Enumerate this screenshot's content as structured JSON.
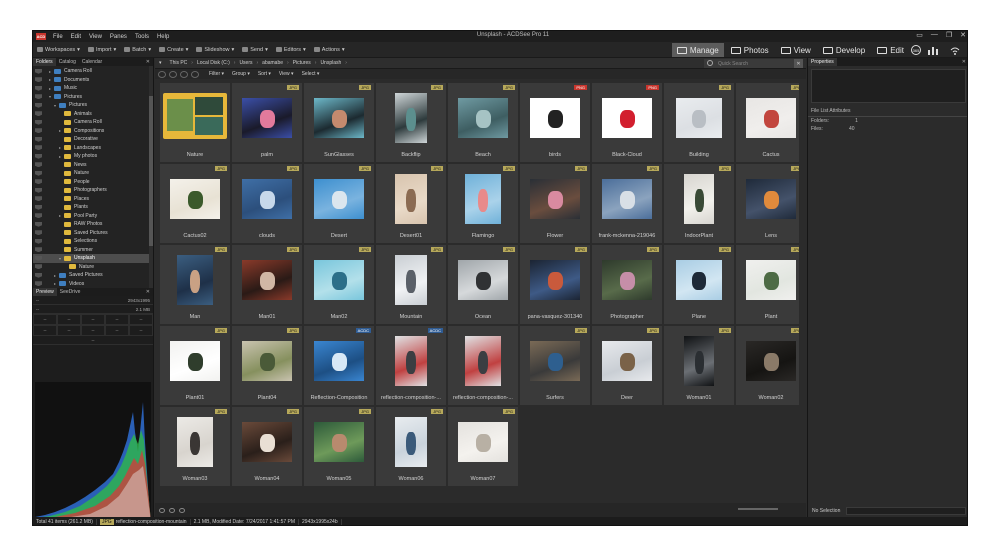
{
  "app": {
    "title": "Unsplash - ACDSee Pro 11",
    "logo": "ACD",
    "window_buttons": [
      "▭",
      "—",
      "❐",
      "✕"
    ]
  },
  "menu": [
    "File",
    "Edit",
    "View",
    "Panes",
    "Tools",
    "Help"
  ],
  "toolbar": {
    "items": [
      "Workspaces",
      "Import",
      "Batch",
      "Create",
      "Slideshow",
      "Send",
      "Editors",
      "Actions"
    ],
    "modes": [
      "Manage",
      "Photos",
      "View",
      "Develop",
      "Edit"
    ],
    "active_mode": "Manage",
    "badge_365": "365"
  },
  "folders_panel": {
    "tabs": [
      "Folders",
      "Catalog",
      "Calendar"
    ],
    "pin": "✕",
    "tree": [
      {
        "label": "Camera Roll",
        "indent": 1,
        "arrow": "▸",
        "icon": "blue"
      },
      {
        "label": "Documents",
        "indent": 1,
        "arrow": "▸",
        "icon": "blue"
      },
      {
        "label": "Music",
        "indent": 1,
        "arrow": "▸",
        "icon": "blue"
      },
      {
        "label": "Pictures",
        "indent": 1,
        "arrow": "▾",
        "icon": "blue"
      },
      {
        "label": "Pictures",
        "indent": 2,
        "arrow": "▾",
        "icon": "blue"
      },
      {
        "label": "Animals",
        "indent": 3,
        "arrow": "",
        "icon": "yellow"
      },
      {
        "label": "Camera Roll",
        "indent": 3,
        "arrow": "",
        "icon": "yellow"
      },
      {
        "label": "Compositions",
        "indent": 3,
        "arrow": "▸",
        "icon": "yellow"
      },
      {
        "label": "Decorative",
        "indent": 3,
        "arrow": "",
        "icon": "yellow"
      },
      {
        "label": "Landscapes",
        "indent": 3,
        "arrow": "▸",
        "icon": "yellow"
      },
      {
        "label": "My photos",
        "indent": 3,
        "arrow": "▸",
        "icon": "yellow"
      },
      {
        "label": "News",
        "indent": 3,
        "arrow": "",
        "icon": "yellow"
      },
      {
        "label": "Nature",
        "indent": 3,
        "arrow": "",
        "icon": "yellow"
      },
      {
        "label": "People",
        "indent": 3,
        "arrow": "",
        "icon": "yellow"
      },
      {
        "label": "Photographers",
        "indent": 3,
        "arrow": "",
        "icon": "yellow"
      },
      {
        "label": "Places",
        "indent": 3,
        "arrow": "",
        "icon": "yellow"
      },
      {
        "label": "Plants",
        "indent": 3,
        "arrow": "",
        "icon": "yellow"
      },
      {
        "label": "Pool Party",
        "indent": 3,
        "arrow": "▸",
        "icon": "yellow"
      },
      {
        "label": "RAW Photos",
        "indent": 3,
        "arrow": "",
        "icon": "yellow"
      },
      {
        "label": "Saved Pictures",
        "indent": 3,
        "arrow": "",
        "icon": "yellow"
      },
      {
        "label": "Selections",
        "indent": 3,
        "arrow": "",
        "icon": "yellow"
      },
      {
        "label": "Summer",
        "indent": 3,
        "arrow": "",
        "icon": "yellow"
      },
      {
        "label": "Unsplash",
        "indent": 3,
        "arrow": "▾",
        "icon": "yellow",
        "selected": true
      },
      {
        "label": "Nature",
        "indent": 4,
        "arrow": "",
        "icon": "yellow"
      },
      {
        "label": "Saved Pictures",
        "indent": 2,
        "arrow": "▸",
        "icon": "blue"
      },
      {
        "label": "Videos",
        "indent": 2,
        "arrow": "▸",
        "icon": "blue"
      }
    ]
  },
  "preview_panel": {
    "tabs": [
      "Preview",
      "SeeDrive"
    ],
    "pin": "✕",
    "dimensions": "2943x1995",
    "size": "2.1 MB",
    "row1_left": "--",
    "row2_left": "--",
    "grid": [
      "--",
      "--",
      "--",
      "--",
      "--",
      "--",
      "--",
      "--",
      "--",
      "--"
    ],
    "bottom": "--"
  },
  "address_bar": {
    "path": [
      "This PC",
      "Local Disk (C:)",
      "Users",
      "abamabe",
      "Pictures",
      "Unsplash"
    ],
    "search_placeholder": "Quick Search",
    "clear": "✕"
  },
  "filter_bar": [
    "Filter",
    "Group",
    "Sort",
    "View",
    "Select"
  ],
  "files": [
    {
      "name": "Nature",
      "badge": "",
      "type": "folder"
    },
    {
      "name": "palm",
      "badge": "JPG",
      "colors": [
        "#3b4fa8",
        "#e27a9c",
        "#1a1a2a"
      ]
    },
    {
      "name": "SunGlasses",
      "badge": "JPG",
      "colors": [
        "#6db8c9",
        "#c48a6e",
        "#1c2a30"
      ]
    },
    {
      "name": "Backflip",
      "badge": "JPG",
      "colors": [
        "#cfd6d8",
        "#5c8f8e",
        "#2d3a3c"
      ]
    },
    {
      "name": "Beach",
      "badge": "JPG",
      "colors": [
        "#6f9aa2",
        "#a6c3c4",
        "#3e5e62"
      ]
    },
    {
      "name": "birds",
      "badge": "PNG",
      "colors": [
        "#ffffff",
        "#222222",
        "#ffffff"
      ]
    },
    {
      "name": "Black-Cloud",
      "badge": "PNG",
      "colors": [
        "#ffffff",
        "#d21f2e",
        "#ffffff"
      ]
    },
    {
      "name": "Building",
      "badge": "JPG",
      "colors": [
        "#e9ecef",
        "#b9bec4",
        "#dcdfe3"
      ]
    },
    {
      "name": "Cactus",
      "badge": "JPG",
      "colors": [
        "#e8e6e4",
        "#c2463e",
        "#f0eeec"
      ]
    },
    {
      "name": "Cactus02",
      "badge": "JPG",
      "colors": [
        "#f4f1ea",
        "#3b5a2b",
        "#e8e2d4"
      ]
    },
    {
      "name": "clouds",
      "badge": "JPG",
      "colors": [
        "#3f6fa6",
        "#c7d8ea",
        "#2c4f7c"
      ]
    },
    {
      "name": "Desert",
      "badge": "JPG",
      "colors": [
        "#3d8fcf",
        "#dbe6ee",
        "#7ab3df"
      ]
    },
    {
      "name": "Desert01",
      "badge": "JPG",
      "colors": [
        "#d8c4ae",
        "#8b6b52",
        "#e9dac8"
      ]
    },
    {
      "name": "Flamingo",
      "badge": "JPG",
      "colors": [
        "#6fb1d9",
        "#e88a8a",
        "#aad2ea"
      ]
    },
    {
      "name": "Flower",
      "badge": "JPG",
      "colors": [
        "#2a2f36",
        "#d98aa0",
        "#6a4d3e"
      ]
    },
    {
      "name": "frank-mckenna-219046",
      "badge": "JPG",
      "colors": [
        "#4b6e9a",
        "#d8dfe6",
        "#8ba3be"
      ]
    },
    {
      "name": "IndoorPlant",
      "badge": "JPG",
      "colors": [
        "#d7d5d0",
        "#394a36",
        "#f2f1ec"
      ]
    },
    {
      "name": "Lens",
      "badge": "JPG",
      "colors": [
        "#1f2a3a",
        "#e08a3c",
        "#44526a"
      ]
    },
    {
      "name": "Man",
      "badge": "JPG",
      "colors": [
        "#3b5e80",
        "#c9a184",
        "#1e3048"
      ]
    },
    {
      "name": "Man01",
      "badge": "JPG",
      "colors": [
        "#8a3a2a",
        "#d1b7a5",
        "#2a1a16"
      ]
    },
    {
      "name": "Man02",
      "badge": "JPG",
      "colors": [
        "#79c6dc",
        "#2c6f89",
        "#b3e0ea"
      ]
    },
    {
      "name": "Mountain",
      "badge": "JPG",
      "colors": [
        "#c9ced3",
        "#5a6068",
        "#f0f2f4"
      ]
    },
    {
      "name": "Ocean",
      "badge": "JPG",
      "colors": [
        "#a0a6aa",
        "#303234",
        "#d6d9db"
      ]
    },
    {
      "name": "pana-vasquez-301340",
      "badge": "JPG",
      "colors": [
        "#1b2433",
        "#c95a3c",
        "#3e5a86"
      ]
    },
    {
      "name": "Photographer",
      "badge": "JPG",
      "colors": [
        "#2e3a2c",
        "#c68ea8",
        "#586b4a"
      ]
    },
    {
      "name": "Plane",
      "badge": "JPG",
      "colors": [
        "#a9cde4",
        "#1e2a38",
        "#d2e6f2"
      ]
    },
    {
      "name": "Plant",
      "badge": "JPG",
      "colors": [
        "#f0f0ee",
        "#4d6b45",
        "#e2e6e0"
      ]
    },
    {
      "name": "Plant01",
      "badge": "JPG",
      "colors": [
        "#f2f2f0",
        "#2f3d2c",
        "#ffffff"
      ]
    },
    {
      "name": "Plant04",
      "badge": "JPG",
      "colors": [
        "#c9c3b0",
        "#4a5a38",
        "#86905e"
      ]
    },
    {
      "name": "Reflection-Composition",
      "badge": "ACDC",
      "colors": [
        "#3a86d1",
        "#d8e8f6",
        "#1d4f84"
      ]
    },
    {
      "name": "reflection-composition-...",
      "badge": "ACDC",
      "colors": [
        "#e0e2e4",
        "#3b3e42",
        "#c04040"
      ]
    },
    {
      "name": "reflection-composition-...",
      "badge": "",
      "colors": [
        "#e0e2e4",
        "#3b3e42",
        "#c04040"
      ]
    },
    {
      "name": "Surfers",
      "badge": "JPG",
      "colors": [
        "#7a6a56",
        "#2e5f8f",
        "#3a3a3a"
      ]
    },
    {
      "name": "Deer",
      "badge": "JPG",
      "colors": [
        "#e7e9ec",
        "#7a6248",
        "#c9ced4"
      ]
    },
    {
      "name": "Woman01",
      "badge": "JPG",
      "colors": [
        "#101214",
        "#2a2e32",
        "#6b6f74"
      ]
    },
    {
      "name": "Woman02",
      "badge": "JPG",
      "colors": [
        "#2a2826",
        "#8a7a68",
        "#151412"
      ]
    },
    {
      "name": "Woman03",
      "badge": "JPG",
      "colors": [
        "#eceae6",
        "#3a3634",
        "#d8d4ce"
      ]
    },
    {
      "name": "Woman04",
      "badge": "JPG",
      "colors": [
        "#6a4a3a",
        "#e9dfd4",
        "#2a1f1a"
      ]
    },
    {
      "name": "Woman05",
      "badge": "JPG",
      "colors": [
        "#2d5a3a",
        "#b88a6e",
        "#6e9a5a"
      ]
    },
    {
      "name": "Woman06",
      "badge": "JPG",
      "colors": [
        "#e8ecef",
        "#3a5a7a",
        "#c9d3dc"
      ]
    },
    {
      "name": "Woman07",
      "badge": "JPG",
      "colors": [
        "#e4e2de",
        "#b8b0a4",
        "#f4f2ee"
      ]
    }
  ],
  "properties_panel": {
    "title": "Properties",
    "pin": "✕",
    "section": "File List Attributes",
    "rows": [
      {
        "label": "Folders:",
        "value": "1"
      },
      {
        "label": "Files:",
        "value": "40"
      }
    ],
    "no_selection": "No Selection"
  },
  "status_bar": {
    "total": "Total 41 items  (261.2 MB)",
    "filetype": "JPG",
    "filename": "reflection-composition-mountain",
    "info": "2.1 MB, Modified Date: 7/24/2017 1:41:57 PM",
    "dims": "2943x1995x24b"
  }
}
